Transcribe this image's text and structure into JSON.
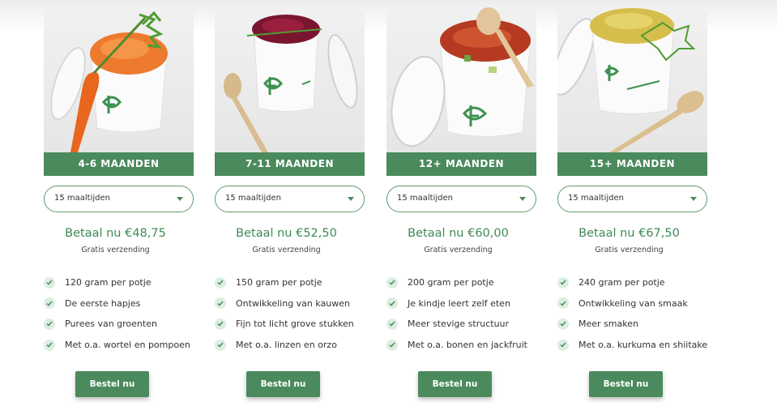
{
  "products": [
    {
      "age_label": "4-6 MAANDEN",
      "portion_select": "15 maaltijden",
      "price": "Betaal nu €48,75",
      "shipping": "Gratis verzending",
      "features": [
        "120 gram per potje",
        "De eerste hapjes",
        "Purees van groenten",
        "Met o.a. wortel en pompoen"
      ],
      "order_label": "Bestel nu"
    },
    {
      "age_label": "7-11 MAANDEN",
      "portion_select": "15 maaltijden",
      "price": "Betaal nu €52,50",
      "shipping": "Gratis verzending",
      "features": [
        "150 gram per potje",
        "Ontwikkeling van kauwen",
        "Fijn tot licht grove stukken",
        "Met o.a. linzen en orzo"
      ],
      "order_label": "Bestel nu"
    },
    {
      "age_label": "12+ MAANDEN",
      "portion_select": "15 maaltijden",
      "price": "Betaal nu €60,00",
      "shipping": "Gratis verzending",
      "features": [
        "200 gram per potje",
        "Je kindje leert zelf eten",
        "Meer stevige structuur",
        "Met o.a. bonen en jackfruit"
      ],
      "order_label": "Bestel nu"
    },
    {
      "age_label": "15+ MAANDEN",
      "portion_select": "15 maaltijden",
      "price": "Betaal nu €67,50",
      "shipping": "Gratis verzending",
      "features": [
        "240 gram per potje",
        "Ontwikkeling van smaak",
        "Meer smaken",
        "Met o.a. kurkuma en shiitake"
      ],
      "order_label": "Bestel nu"
    }
  ],
  "colors": {
    "brand_green": "#4a8a5c",
    "check_bg": "#dceee1",
    "price_green": "#3f8a55"
  },
  "icons": {
    "feature_check": "check-icon",
    "select_caret": "chevron-down-icon"
  }
}
